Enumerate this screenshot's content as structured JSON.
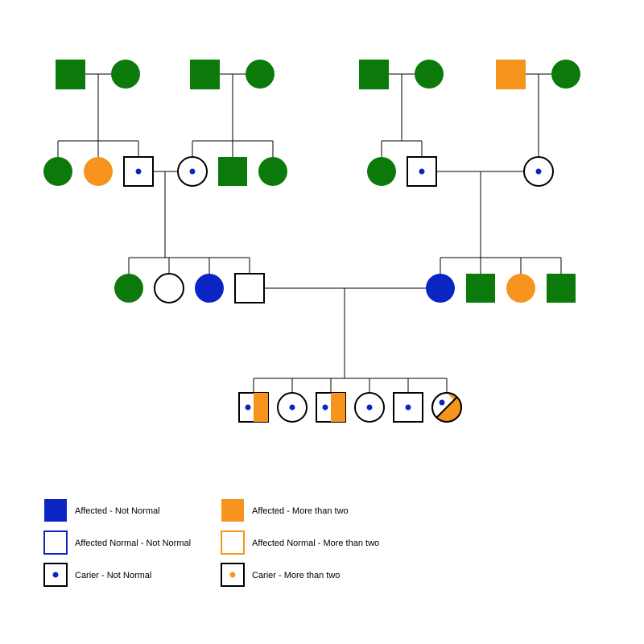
{
  "colors": {
    "green": "#0b7a0b",
    "orange": "#f7941d",
    "blue": "#0b24c4",
    "white": "#ffffff",
    "black": "#000000"
  },
  "legend": {
    "affected_not_normal": "Affected - Not Normal",
    "affected_normal_not_normal": "Affected Normal - Not Normal",
    "carrier_not_normal": "Carier - Not Normal",
    "affected_more_than_two": "Affected - More than two",
    "affected_normal_more_than_two": "Affected Normal - More than two",
    "carrier_more_than_two": "Carier - More than two"
  },
  "chart_data": {
    "type": "table",
    "description": "Pedigree chart, 4 generations",
    "shapes": {
      "square": "male",
      "circle": "female"
    },
    "status_key": {
      "green": "unaffected (default fill)",
      "orange": "Affected - More than two",
      "blue": "Affected - Not Normal",
      "white_outline_blue": "Affected Normal - Not Normal",
      "white_outline_orange": "Affected Normal - More than two",
      "dot_blue": "Carrier - Not Normal",
      "dot_orange": "Carrier - More than two",
      "half_orange": "half-shaded More than two"
    },
    "generations": [
      {
        "id": "I",
        "couples": [
          {
            "id": "I-A",
            "father": {
              "shape": "square",
              "fill": "green"
            },
            "mother": {
              "shape": "circle",
              "fill": "green"
            }
          },
          {
            "id": "I-B",
            "father": {
              "shape": "square",
              "fill": "green"
            },
            "mother": {
              "shape": "circle",
              "fill": "green"
            }
          },
          {
            "id": "I-C",
            "father": {
              "shape": "square",
              "fill": "green"
            },
            "mother": {
              "shape": "circle",
              "fill": "green"
            }
          },
          {
            "id": "I-D",
            "father": {
              "shape": "square",
              "fill": "orange"
            },
            "mother": {
              "shape": "circle",
              "fill": "green"
            }
          }
        ]
      },
      {
        "id": "II",
        "sibships": [
          {
            "parents": "I-A",
            "children": [
              {
                "shape": "circle",
                "fill": "green"
              },
              {
                "shape": "circle",
                "fill": "orange"
              },
              {
                "shape": "square",
                "fill": "white",
                "outline": "black",
                "carrier_dot": "blue",
                "mates_with": "II-B-1"
              }
            ]
          },
          {
            "parents": "I-B",
            "children": [
              {
                "shape": "circle",
                "fill": "white",
                "outline": "black",
                "carrier_dot": "blue",
                "id": "II-B-1"
              },
              {
                "shape": "square",
                "fill": "green"
              },
              {
                "shape": "circle",
                "fill": "green"
              }
            ]
          },
          {
            "parents": "I-C",
            "children": [
              {
                "shape": "circle",
                "fill": "green"
              },
              {
                "shape": "square",
                "fill": "white",
                "outline": "black",
                "carrier_dot": "blue",
                "mates_with": "II-D-1"
              }
            ]
          },
          {
            "parents": "I-D",
            "children": [
              {
                "shape": "circle",
                "fill": "white",
                "outline": "black",
                "carrier_dot": "blue",
                "id": "II-D-1"
              }
            ]
          }
        ]
      },
      {
        "id": "III",
        "sibships": [
          {
            "parents": "II-A3 × II-B1",
            "children": [
              {
                "shape": "circle",
                "fill": "green"
              },
              {
                "shape": "circle",
                "fill": "white",
                "outline": "black"
              },
              {
                "shape": "circle",
                "fill": "blue"
              },
              {
                "shape": "square",
                "fill": "white",
                "outline": "black",
                "mates_with": "III-R-1"
              }
            ]
          },
          {
            "parents": "II-C2 × II-D1",
            "children": [
              {
                "shape": "circle",
                "fill": "blue",
                "id": "III-R-1"
              },
              {
                "shape": "square",
                "fill": "green"
              },
              {
                "shape": "circle",
                "fill": "orange"
              },
              {
                "shape": "square",
                "fill": "green"
              }
            ]
          }
        ]
      },
      {
        "id": "IV",
        "sibships": [
          {
            "parents": "III-L4 × III-R1",
            "children": [
              {
                "shape": "square",
                "fill": "white",
                "outline": "black",
                "carrier_dot": "blue",
                "half": "orange"
              },
              {
                "shape": "circle",
                "fill": "white",
                "outline": "black",
                "carrier_dot": "blue"
              },
              {
                "shape": "square",
                "fill": "white",
                "outline": "black",
                "carrier_dot": "blue",
                "half": "orange"
              },
              {
                "shape": "circle",
                "fill": "white",
                "outline": "black",
                "carrier_dot": "blue"
              },
              {
                "shape": "square",
                "fill": "white",
                "outline": "black",
                "carrier_dot": "blue"
              },
              {
                "shape": "circle",
                "fill": "white",
                "outline": "black",
                "carrier_dot": "blue",
                "half": "orange"
              }
            ]
          }
        ]
      }
    ]
  }
}
